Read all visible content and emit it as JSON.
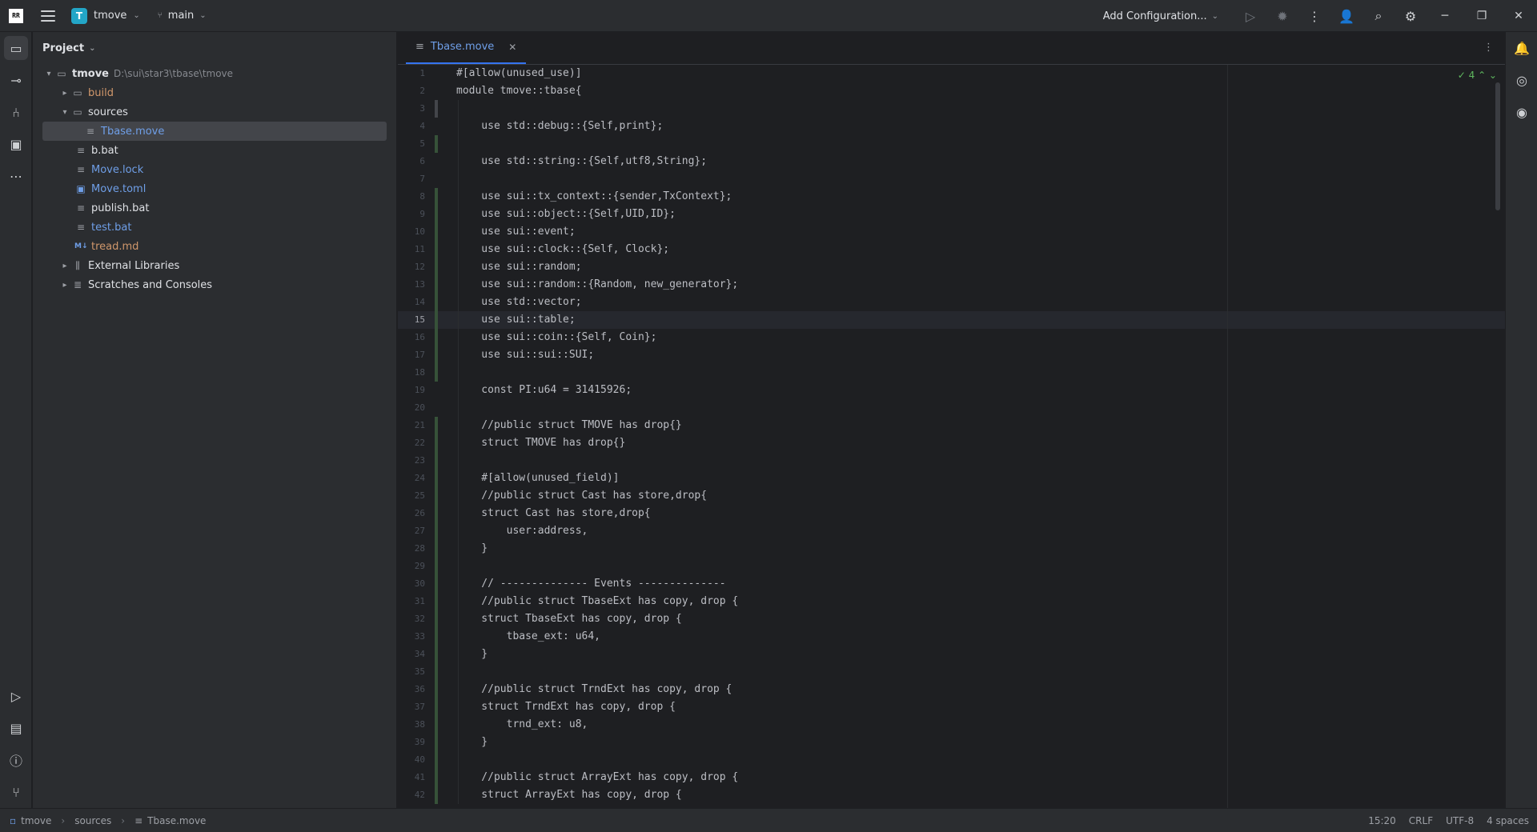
{
  "titlebar": {
    "project_name": "tmove",
    "project_initial": "T",
    "branch": "main",
    "run_config": "Add Configuration...",
    "colors": {
      "project_badge": "#23a6c7"
    }
  },
  "project_panel": {
    "title": "Project",
    "root": {
      "name": "tmove",
      "path": "D:\\sui\\star3\\tbase\\tmove"
    },
    "items": [
      {
        "label": "build"
      },
      {
        "label": "sources"
      },
      {
        "label": "Tbase.move"
      },
      {
        "label": "b.bat"
      },
      {
        "label": "Move.lock"
      },
      {
        "label": "Move.toml"
      },
      {
        "label": "publish.bat"
      },
      {
        "label": "test.bat"
      },
      {
        "label": "tread.md"
      },
      {
        "label": "External Libraries"
      },
      {
        "label": "Scratches and Consoles"
      }
    ]
  },
  "editor": {
    "tab_label": "Tbase.move",
    "inspection_count": "4",
    "current_line": 15,
    "lines": [
      "#[allow(unused_use)]",
      "module tmove::tbase{",
      "",
      "    use std::debug::{Self,print};",
      "",
      "    use std::string::{Self,utf8,String};",
      "",
      "    use sui::tx_context::{sender,TxContext};",
      "    use sui::object::{Self,UID,ID};",
      "    use sui::event;",
      "    use sui::clock::{Self, Clock};",
      "    use sui::random;",
      "    use sui::random::{Random, new_generator};",
      "    use std::vector;",
      "    use sui::table;",
      "    use sui::coin::{Self, Coin};",
      "    use sui::sui::SUI;",
      "",
      "    const PI:u64 = 31415926;",
      "",
      "    //public struct TMOVE has drop{}",
      "    struct TMOVE has drop{}",
      "",
      "    #[allow(unused_field)]",
      "    //public struct Cast has store,drop{",
      "    struct Cast has store,drop{",
      "        user:address,",
      "    }",
      "",
      "    // -------------- Events --------------",
      "    //public struct TbaseExt has copy, drop {",
      "    struct TbaseExt has copy, drop {",
      "        tbase_ext: u64,",
      "    }",
      "",
      "    //public struct TrndExt has copy, drop {",
      "    struct TrndExt has copy, drop {",
      "        trnd_ext: u8,",
      "    }",
      "",
      "    //public struct ArrayExt has copy, drop {",
      "    struct ArrayExt has copy, drop {"
    ]
  },
  "statusbar": {
    "breadcrumb": [
      "tmove",
      "sources",
      "Tbase.move"
    ],
    "position": "15:20",
    "line_sep": "CRLF",
    "encoding": "UTF-8",
    "indent": "4 spaces"
  }
}
